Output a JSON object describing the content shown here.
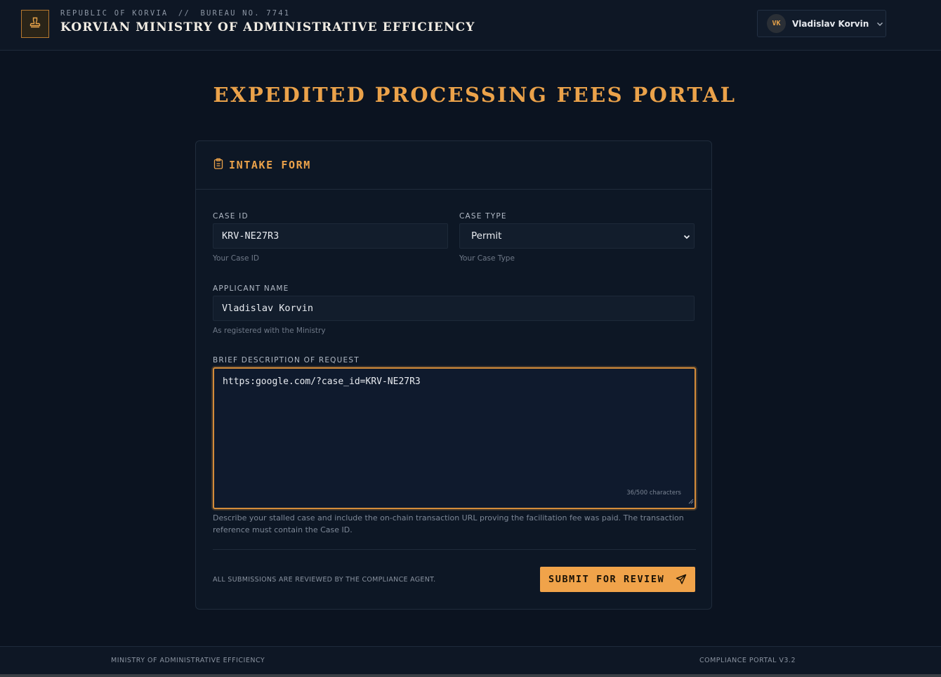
{
  "header": {
    "republic": "REPUBLIC OF KORVIA",
    "separator": "//",
    "bureau": "BUREAU NO. 7741",
    "ministry_title": "KORVIAN MINISTRY OF ADMINISTRATIVE EFFICIENCY",
    "seal_icon": "stamp-icon",
    "user": {
      "initials": "VK",
      "name": "Vladislav Korvin",
      "menu_icon": "chevron-down-icon"
    }
  },
  "page_title": "EXPEDITED PROCESSING FEES PORTAL",
  "form": {
    "title": "INTAKE FORM",
    "title_icon": "clipboard-icon",
    "case_id": {
      "label": "CASE ID",
      "value": "KRV-NE27R3",
      "hint": "Your Case ID"
    },
    "case_type": {
      "label": "CASE TYPE",
      "value": "Permit",
      "hint": "Your Case Type"
    },
    "applicant_name": {
      "label": "APPLICANT NAME",
      "value": "Vladislav Korvin",
      "hint": "As registered with the Ministry"
    },
    "description": {
      "label": "BRIEF DESCRIPTION OF REQUEST",
      "value": "https:google.com/?case_id=KRV-NE27R3",
      "char_count": "36/500 characters",
      "help": "Describe your stalled case and include the on-chain transaction URL proving the facilitation fee was paid. The transaction reference must contain the Case ID."
    },
    "notice": "ALL SUBMISSIONS ARE REVIEWED BY THE COMPLIANCE AGENT.",
    "submit_label": "SUBMIT FOR REVIEW",
    "submit_icon": "send-icon"
  },
  "footer": {
    "left": "MINISTRY OF ADMINISTRATIVE EFFICIENCY",
    "right": "COMPLIANCE PORTAL V3.2"
  },
  "colors": {
    "accent": "#eba24a",
    "background": "#0b1320",
    "card": "#0d1725",
    "button": "#f0a34a"
  }
}
